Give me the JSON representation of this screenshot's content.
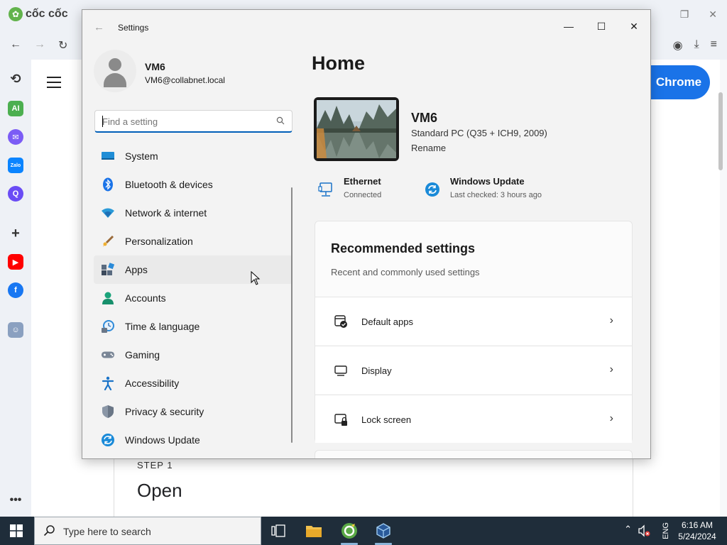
{
  "browser": {
    "name": "cốc cốc",
    "chrome_button": "Chrome",
    "step_label": "STEP 1",
    "step_title": "Open"
  },
  "settings": {
    "title": "Settings",
    "profile": {
      "name": "VM6",
      "email": "VM6@collabnet.local"
    },
    "search": {
      "placeholder": "Find a setting"
    },
    "nav": [
      {
        "label": "System",
        "icon": "system-icon"
      },
      {
        "label": "Bluetooth & devices",
        "icon": "bluetooth-icon"
      },
      {
        "label": "Network & internet",
        "icon": "wifi-icon"
      },
      {
        "label": "Personalization",
        "icon": "brush-icon"
      },
      {
        "label": "Apps",
        "icon": "apps-icon"
      },
      {
        "label": "Accounts",
        "icon": "accounts-icon"
      },
      {
        "label": "Time & language",
        "icon": "time-language-icon"
      },
      {
        "label": "Gaming",
        "icon": "gamepad-icon"
      },
      {
        "label": "Accessibility",
        "icon": "accessibility-icon"
      },
      {
        "label": "Privacy & security",
        "icon": "shield-icon"
      },
      {
        "label": "Windows Update",
        "icon": "windows-update-icon"
      }
    ],
    "home": {
      "title": "Home",
      "device": {
        "name": "VM6",
        "spec": "Standard PC (Q35 + ICH9, 2009)",
        "rename": "Rename"
      },
      "ethernet": {
        "title": "Ethernet",
        "status": "Connected"
      },
      "update": {
        "title": "Windows Update",
        "status": "Last checked: 3 hours ago"
      },
      "recommended": {
        "title": "Recommended settings",
        "subtitle": "Recent and commonly used settings",
        "items": [
          {
            "label": "Default apps",
            "icon": "default-apps-icon"
          },
          {
            "label": "Display",
            "icon": "display-icon"
          },
          {
            "label": "Lock screen",
            "icon": "lock-screen-icon"
          }
        ]
      }
    }
  },
  "taskbar": {
    "search_text": "Type here to search",
    "lang": "ENG",
    "time": "6:16 AM",
    "date": "5/24/2024"
  }
}
